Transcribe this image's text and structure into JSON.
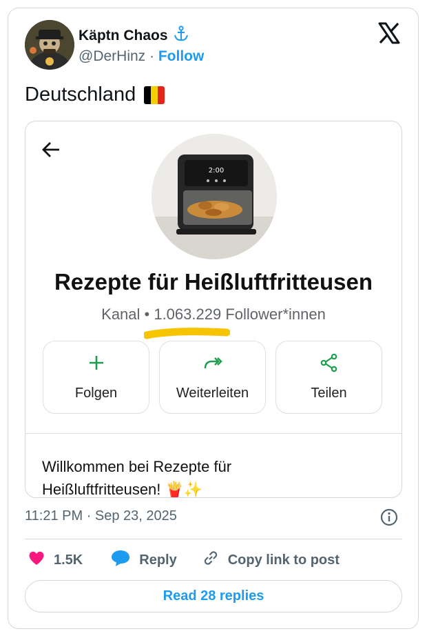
{
  "author": {
    "display_name": "Käptn Chaos",
    "name_emoji": "⚓",
    "handle": "@DerHinz",
    "separator": "·",
    "follow_label": "Follow"
  },
  "tweet": {
    "text": "Deutschland",
    "flag_colors": [
      "#000000",
      "#f5d000",
      "#e1261c"
    ]
  },
  "embed": {
    "channel_name": "Rezepte für Heißluftfritteusen",
    "channel_meta": "Kanal • 1.063.229 Follower*innen",
    "highlight_color": "#f6c400",
    "actions": [
      {
        "label": "Folgen",
        "icon": "plus-icon"
      },
      {
        "label": "Weiterleiten",
        "icon": "forward-icon"
      },
      {
        "label": "Teilen",
        "icon": "share-icon"
      }
    ],
    "action_icon_color": "#1a9e4b",
    "welcome_line1": "Willkommen bei Rezepte für",
    "welcome_line2": "Heißluftfritteusen!",
    "welcome_emojis": "🍟✨"
  },
  "meta": {
    "time": "11:21 PM · Sep 23, 2025"
  },
  "engagement": {
    "likes": "1.5K",
    "reply_label": "Reply",
    "copy_label": "Copy link to post",
    "like_color": "#f91880",
    "reply_color": "#1d9bf0"
  },
  "read_replies_label": "Read 28 replies"
}
